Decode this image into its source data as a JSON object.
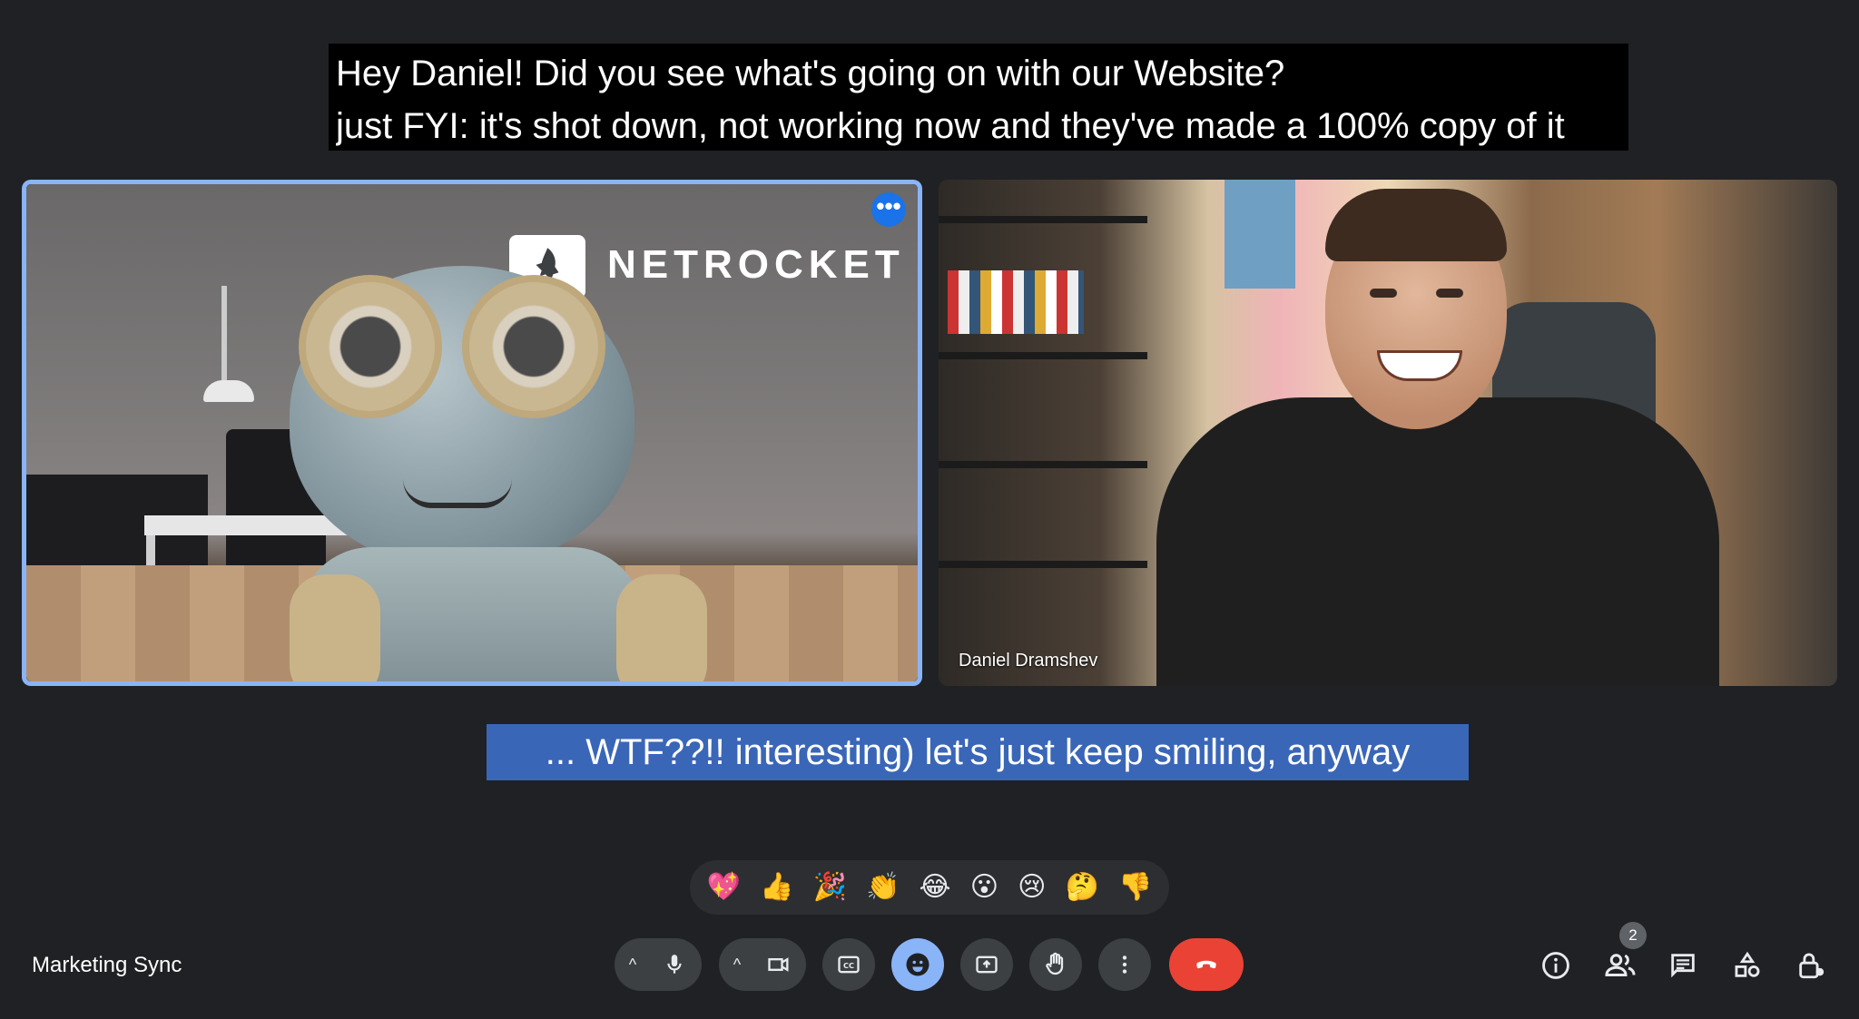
{
  "captions": {
    "top_line1": "Hey Daniel! Did you see what's going on with our Website?",
    "top_line2": "just FYI: it's shot down, not working now and they've made a 100% copy of it",
    "bottom": "... WTF??!! interesting) let's just keep smiling, anyway"
  },
  "tiles": {
    "left": {
      "logo_text": "NETROCKET",
      "more_label": "•••"
    },
    "right": {
      "participant_name": "Daniel Dramshev"
    }
  },
  "reactions": [
    "💖",
    "👍",
    "🎉",
    "👏",
    "😂",
    "😮",
    "😢",
    "🤔",
    "👎"
  ],
  "meeting": {
    "name": "Marketing Sync"
  },
  "controls": {
    "chevron": "^",
    "participants_count": "2"
  },
  "colors": {
    "background": "#202124",
    "active_speaker_border": "#8ab4f8",
    "control_bg": "#3c4043",
    "end_call": "#ea4335",
    "caption_highlight": "#3a66b7"
  }
}
